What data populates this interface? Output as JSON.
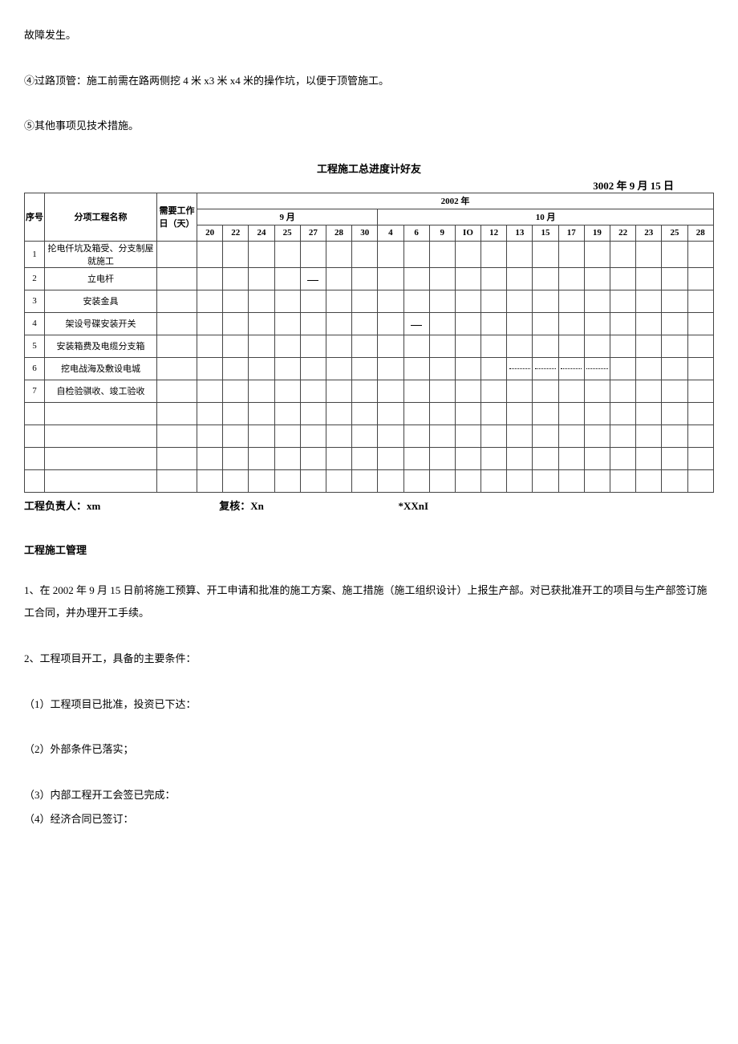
{
  "paragraphs": {
    "p1": "故障发生。",
    "p2": "④过路顶管：施工前需在路两侧挖 4 米 x3 米 x4 米的操作坑，以便于顶管施工。",
    "p3": "⑤其他事项见技术措施。"
  },
  "chart": {
    "title": "工程施工总进度计好友",
    "date": "3002 年 9 月 15 日",
    "year": "2002 年",
    "month1": "9 月",
    "month2": "10 月",
    "col_seq": "序号",
    "col_name": "分项工程名称",
    "col_days": "需要工作日（天）",
    "days": [
      "20",
      "22",
      "24",
      "25",
      "27",
      "28",
      "30",
      "4",
      "6",
      "9",
      "IO",
      "12",
      "13",
      "15",
      "17",
      "19",
      "22",
      "23",
      "25",
      "28"
    ]
  },
  "rows": [
    {
      "num": "1",
      "name": "抡电仟坑及箱受、分支制屋就施工"
    },
    {
      "num": "2",
      "name": "立电杆"
    },
    {
      "num": "3",
      "name": "安装金具"
    },
    {
      "num": "4",
      "name": "架设号碟安装开关"
    },
    {
      "num": "5",
      "name": "安装箱费及电缆分支箱"
    },
    {
      "num": "6",
      "name": "挖电战海及敷设电城"
    },
    {
      "num": "7",
      "name": "自检验骐收、竣工验收"
    }
  ],
  "chart_data": {
    "type": "bar",
    "title": "工程施工总进度计好友",
    "categories": [
      "20",
      "22",
      "24",
      "25",
      "27",
      "28",
      "30",
      "4",
      "6",
      "9",
      "IO",
      "12",
      "13",
      "15",
      "17",
      "19",
      "22",
      "23",
      "25",
      "28"
    ],
    "series": [
      {
        "name": "抡电仟坑及箱受、分支制屋就施工",
        "values": []
      },
      {
        "name": "立电杆",
        "values": [
          {
            "start": "27",
            "end": "27"
          }
        ]
      },
      {
        "name": "安装金具",
        "values": []
      },
      {
        "name": "架设号碟安装开关",
        "values": [
          {
            "start": "6",
            "end": "6"
          }
        ]
      },
      {
        "name": "安装箱费及电缆分支箱",
        "values": []
      },
      {
        "name": "挖电战海及敷设电城",
        "values": [
          {
            "start": "13",
            "end": "19",
            "style": "dotted"
          }
        ]
      },
      {
        "name": "自检验骐收、竣工验收",
        "values": []
      }
    ],
    "xlabel": "",
    "ylabel": ""
  },
  "footer": {
    "left": "工程负责人：xm",
    "mid": "复核：Xn",
    "right": "*XXnI"
  },
  "management": {
    "heading": "工程施工管理",
    "items": {
      "i1": "1、在 2002 年 9 月 15 日前将施工预算、开工申请和批准的施工方案、施工措施（施工组织设计）上报生产部。对已获批准开工的项目与生产部签订施工合同，并办理开工手续。",
      "i2": "2、工程项目开工，具备的主要条件：",
      "i3": "（1）工程项目已批准，投资已下达：",
      "i4": "（2）外部条件已落实；",
      "i5": "（3）内部工程开工会签已完成：",
      "i6": "（4）经济合同已签订："
    }
  }
}
